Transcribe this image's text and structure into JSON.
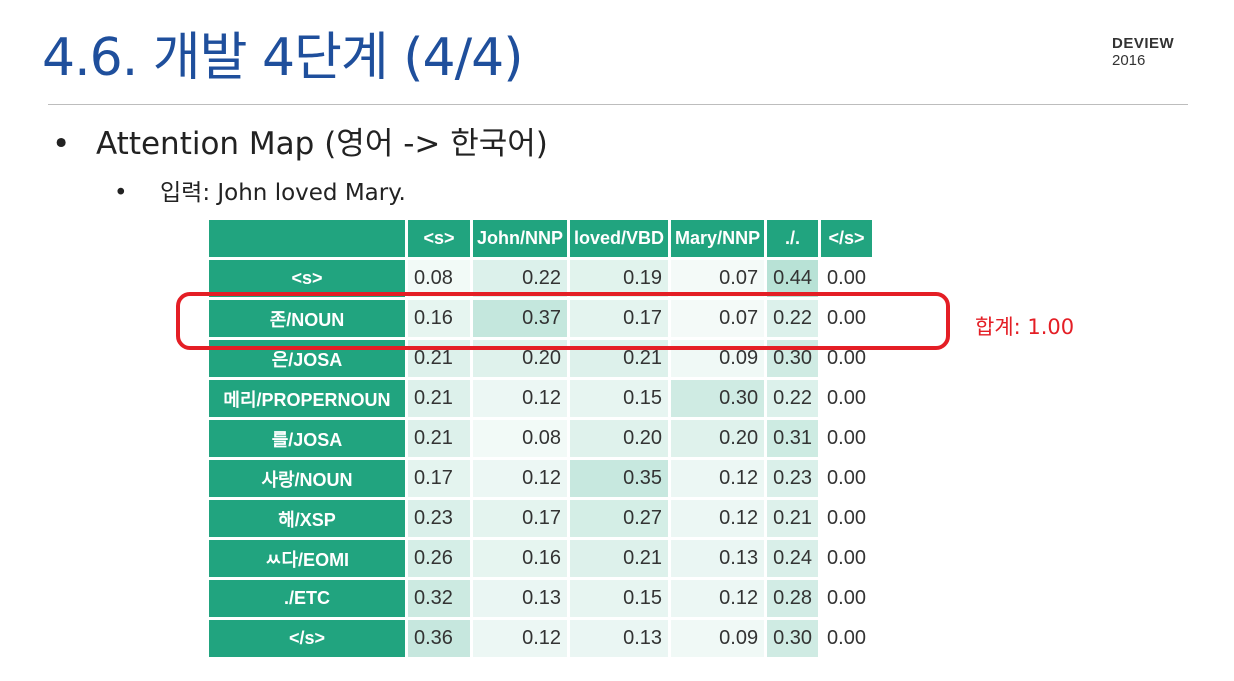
{
  "slide": {
    "title": "4.6. 개발 4단계 (4/4)",
    "brand_line1": "DEVIEW",
    "brand_line2": "2016",
    "bullet_main": "Attention Map (영어 -> 한국어)",
    "bullet_sub": "입력: John loved Mary.",
    "sum_label": "합계: 1.00"
  },
  "chart_data": {
    "type": "heatmap",
    "columns": [
      "<s>",
      "John/NNP",
      "loved/VBD",
      "Mary/NNP",
      "./.",
      "</s>"
    ],
    "rows": [
      {
        "label": "<s>",
        "values": [
          "0.08",
          "0.22",
          "0.19",
          "0.07",
          "0.44",
          "0.00"
        ]
      },
      {
        "label": "존/NOUN",
        "values": [
          "0.16",
          "0.37",
          "0.17",
          "0.07",
          "0.22",
          "0.00"
        ]
      },
      {
        "label": "은/JOSA",
        "values": [
          "0.21",
          "0.20",
          "0.21",
          "0.09",
          "0.30",
          "0.00"
        ]
      },
      {
        "label": "메리/PROPERNOUN",
        "values": [
          "0.21",
          "0.12",
          "0.15",
          "0.30",
          "0.22",
          "0.00"
        ]
      },
      {
        "label": "를/JOSA",
        "values": [
          "0.21",
          "0.08",
          "0.20",
          "0.20",
          "0.31",
          "0.00"
        ]
      },
      {
        "label": "사랑/NOUN",
        "values": [
          "0.17",
          "0.12",
          "0.35",
          "0.12",
          "0.23",
          "0.00"
        ]
      },
      {
        "label": "해/XSP",
        "values": [
          "0.23",
          "0.17",
          "0.27",
          "0.12",
          "0.21",
          "0.00"
        ]
      },
      {
        "label": "ㅆ다/EOMI",
        "values": [
          "0.26",
          "0.16",
          "0.21",
          "0.13",
          "0.24",
          "0.00"
        ]
      },
      {
        "label": "./ETC",
        "values": [
          "0.32",
          "0.13",
          "0.15",
          "0.12",
          "0.28",
          "0.00"
        ]
      },
      {
        "label": "</s>",
        "values": [
          "0.36",
          "0.12",
          "0.13",
          "0.09",
          "0.30",
          "0.00"
        ]
      }
    ],
    "colors": {
      "header": "#21a47f",
      "highlight": "#e41e25"
    }
  }
}
